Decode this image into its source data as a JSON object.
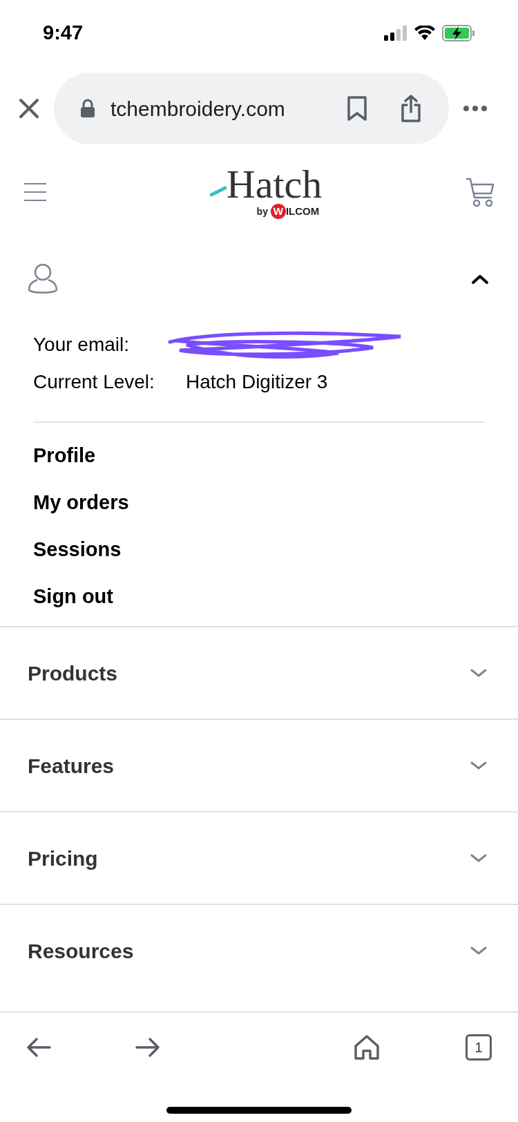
{
  "status_bar": {
    "time": "9:47"
  },
  "browser": {
    "url": "tchembroidery.com"
  },
  "logo": {
    "wordmark": "Hatch",
    "byline": "by",
    "brand_initial": "W",
    "brand_rest": "ILCOM"
  },
  "account": {
    "expanded": true,
    "email_label": "Your email:",
    "level_label": "Current Level:",
    "level_value": "Hatch Digitizer 3",
    "links": [
      "Profile",
      "My orders",
      "Sessions",
      "Sign out"
    ]
  },
  "nav": [
    {
      "label": "Products",
      "expanded": false
    },
    {
      "label": "Features",
      "expanded": false
    },
    {
      "label": "Pricing",
      "expanded": false
    },
    {
      "label": "Resources",
      "expanded": false
    }
  ],
  "toolbar": {
    "tab_count": "1"
  }
}
